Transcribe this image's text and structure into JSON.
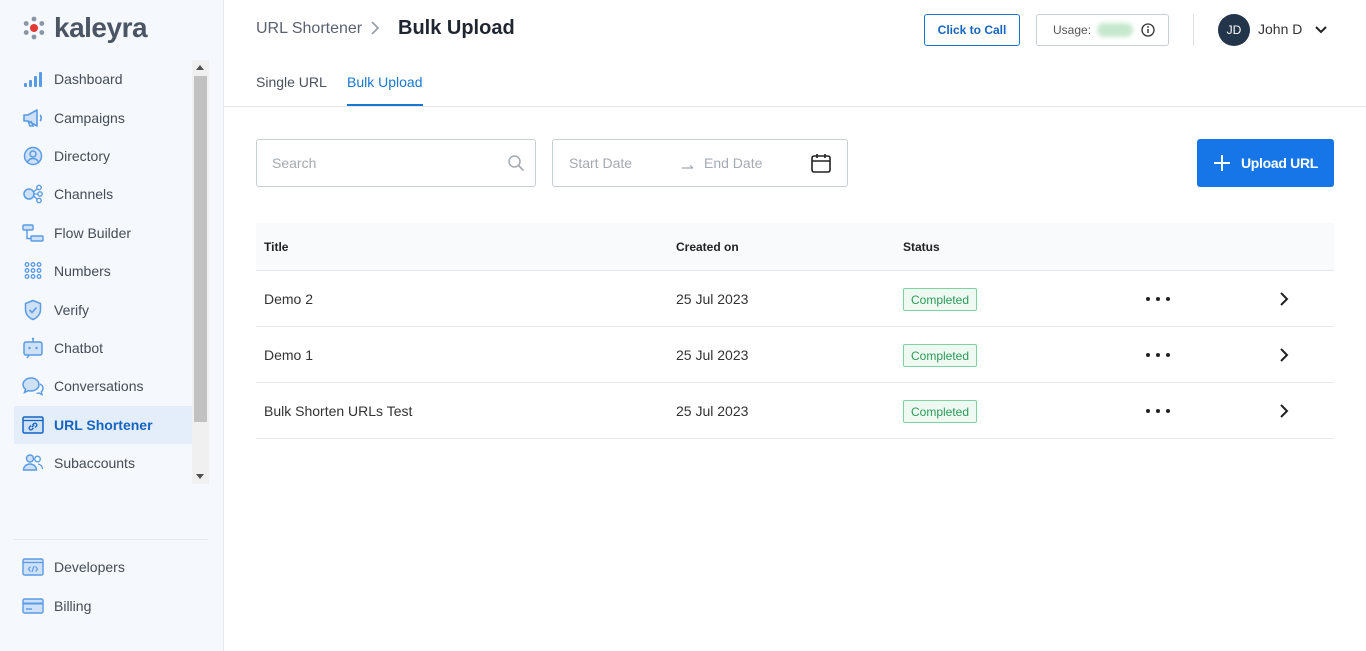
{
  "brand": {
    "name": "kaleyra",
    "accent": "#e53935"
  },
  "sidebar": {
    "items": [
      {
        "label": "Dashboard",
        "icon": "bar-chart-icon"
      },
      {
        "label": "Campaigns",
        "icon": "megaphone-icon"
      },
      {
        "label": "Directory",
        "icon": "user-circle-icon"
      },
      {
        "label": "Channels",
        "icon": "channels-icon"
      },
      {
        "label": "Flow Builder",
        "icon": "flow-icon"
      },
      {
        "label": "Numbers",
        "icon": "dialpad-icon"
      },
      {
        "label": "Verify",
        "icon": "shield-check-icon"
      },
      {
        "label": "Chatbot",
        "icon": "bot-icon"
      },
      {
        "label": "Conversations",
        "icon": "chat-bubbles-icon"
      },
      {
        "label": "URL Shortener",
        "icon": "link-icon",
        "active": true
      },
      {
        "label": "Subaccounts",
        "icon": "users-icon"
      }
    ],
    "bottom": [
      {
        "label": "Developers",
        "icon": "code-icon"
      },
      {
        "label": "Billing",
        "icon": "card-icon"
      }
    ]
  },
  "header": {
    "breadcrumb_parent": "URL Shortener",
    "title": "Bulk Upload",
    "click_to_call": "Click to Call",
    "usage_label": "Usage:",
    "user_initials": "JD",
    "user_name": "John D"
  },
  "tabs": [
    {
      "label": "Single URL",
      "active": false
    },
    {
      "label": "Bulk Upload",
      "active": true
    }
  ],
  "toolbar": {
    "search_placeholder": "Search",
    "start_date_placeholder": "Start Date",
    "end_date_placeholder": "End Date",
    "upload_label": "Upload URL"
  },
  "table": {
    "columns": [
      "Title",
      "Created on",
      "Status"
    ],
    "rows": [
      {
        "title": "Demo 2",
        "created_on": "25 Jul 2023",
        "status": "Completed"
      },
      {
        "title": "Demo 1",
        "created_on": "25 Jul 2023",
        "status": "Completed"
      },
      {
        "title": "Bulk Shorten URLs Test",
        "created_on": "25 Jul 2023",
        "status": "Completed"
      }
    ]
  },
  "colors": {
    "primary": "#1676e8",
    "status_completed": "#2c9a5a"
  }
}
